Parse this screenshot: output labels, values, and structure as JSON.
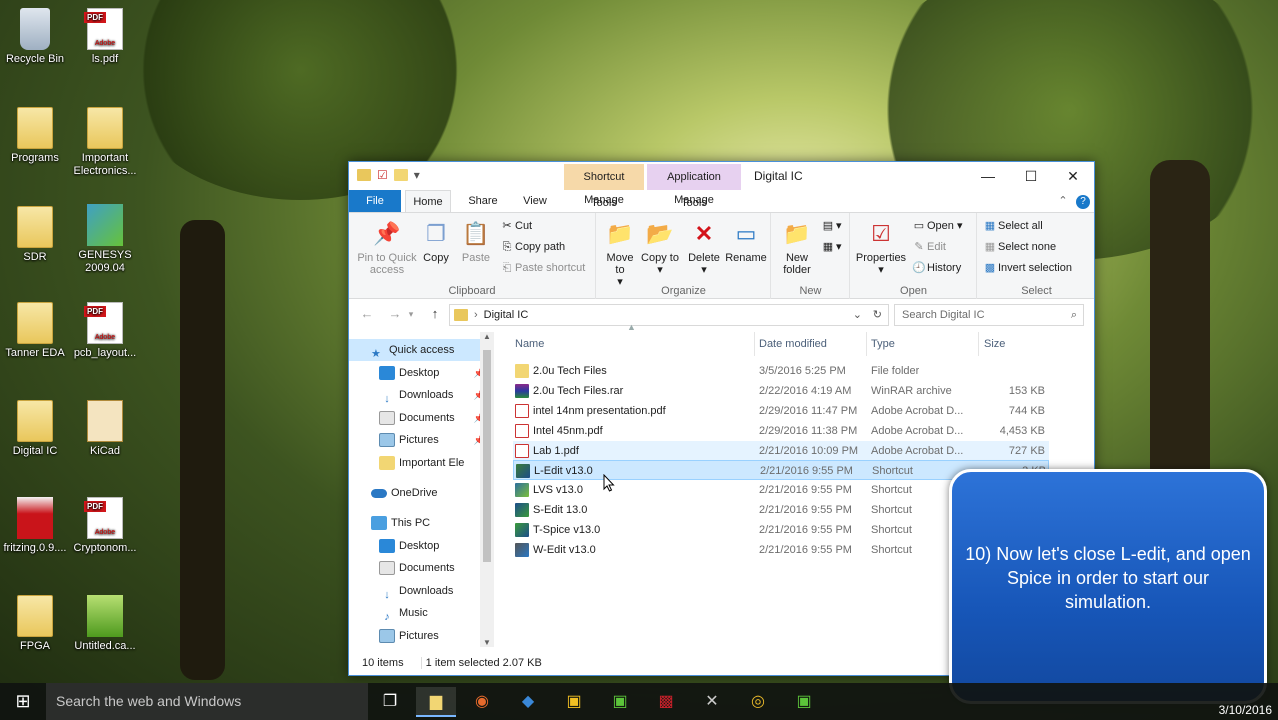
{
  "desktop": {
    "icons": [
      {
        "label": "Recycle Bin",
        "icon": "recycle-bin-icon"
      },
      {
        "label": "ls.pdf",
        "icon": "pdf-file-icon"
      },
      {
        "label": "Programs",
        "icon": "folder-icon"
      },
      {
        "label": "Important Electronics...",
        "icon": "folder-icon"
      },
      {
        "label": "SDR",
        "icon": "folder-icon"
      },
      {
        "label": "GENESYS 2009.04",
        "icon": "genesys-app-icon"
      },
      {
        "label": "Tanner EDA",
        "icon": "folder-icon"
      },
      {
        "label": "pcb_layout...",
        "icon": "pdf-file-icon"
      },
      {
        "label": "Digital IC",
        "icon": "folder-icon"
      },
      {
        "label": "KiCad",
        "icon": "kicad-app-icon"
      },
      {
        "label": "fritzing.0.9....",
        "icon": "folder-icon"
      },
      {
        "label": "Cryptonom...",
        "icon": "pdf-file-icon"
      },
      {
        "label": "FPGA",
        "icon": "folder-icon"
      },
      {
        "label": "Untitled.ca...",
        "icon": "cad-file-icon"
      }
    ]
  },
  "window": {
    "title": "Digital IC",
    "context_tabs": [
      {
        "header": "Shortcut Tools",
        "tab": "Manage",
        "color": "#f6d9a9"
      },
      {
        "header": "Application Tools",
        "tab": "Manage",
        "color": "#e7d1f0"
      }
    ],
    "tabs": [
      "File",
      "Home",
      "Share",
      "View"
    ],
    "ribbon": {
      "clipboard": {
        "title": "Clipboard",
        "pin": "Pin to Quick access",
        "copy": "Copy",
        "paste": "Paste",
        "cut": "Cut",
        "copy_path": "Copy path",
        "paste_shortcut": "Paste shortcut"
      },
      "organize": {
        "title": "Organize",
        "move_to": "Move to",
        "copy_to": "Copy to",
        "delete": "Delete",
        "rename": "Rename"
      },
      "new": {
        "title": "New",
        "new_folder": "New folder"
      },
      "open": {
        "title": "Open",
        "properties": "Properties",
        "open": "Open",
        "edit": "Edit",
        "history": "History"
      },
      "select": {
        "title": "Select",
        "select_all": "Select all",
        "select_none": "Select none",
        "invert": "Invert selection"
      }
    },
    "address": {
      "path": "Digital IC",
      "search_placeholder": "Search Digital IC"
    },
    "nav": {
      "quick_access": "Quick access",
      "quick_items": [
        "Desktop",
        "Downloads",
        "Documents",
        "Pictures",
        "Important Ele"
      ],
      "onedrive": "OneDrive",
      "this_pc": "This PC",
      "pc_items": [
        "Desktop",
        "Documents",
        "Downloads",
        "Music",
        "Pictures"
      ]
    },
    "columns": [
      "Name",
      "Date modified",
      "Type",
      "Size"
    ],
    "files": [
      {
        "name": "2.0u Tech Files",
        "date": "3/5/2016 5:25 PM",
        "type": "File folder",
        "size": "",
        "icon": "folder-icon"
      },
      {
        "name": "2.0u Tech Files.rar",
        "date": "2/22/2016 4:19 AM",
        "type": "WinRAR archive",
        "size": "153 KB",
        "icon": "rar-file-icon"
      },
      {
        "name": "intel 14nm presentation.pdf",
        "date": "2/29/2016 11:47 PM",
        "type": "Adobe Acrobat D...",
        "size": "744 KB",
        "icon": "pdf-file-icon"
      },
      {
        "name": "Intel 45nm.pdf",
        "date": "2/29/2016 11:38 PM",
        "type": "Adobe Acrobat D...",
        "size": "4,453 KB",
        "icon": "pdf-file-icon"
      },
      {
        "name": "Lab 1.pdf",
        "date": "2/21/2016 10:09 PM",
        "type": "Adobe Acrobat D...",
        "size": "727 KB",
        "icon": "pdf-file-icon"
      },
      {
        "name": "L-Edit v13.0",
        "date": "2/21/2016 9:55 PM",
        "type": "Shortcut",
        "size": "3 KB",
        "icon": "ledit-shortcut-icon"
      },
      {
        "name": "LVS v13.0",
        "date": "2/21/2016 9:55 PM",
        "type": "Shortcut",
        "size": "",
        "icon": "lvs-shortcut-icon"
      },
      {
        "name": "S-Edit 13.0",
        "date": "2/21/2016 9:55 PM",
        "type": "Shortcut",
        "size": "",
        "icon": "sedit-shortcut-icon"
      },
      {
        "name": "T-Spice v13.0",
        "date": "2/21/2016 9:55 PM",
        "type": "Shortcut",
        "size": "",
        "icon": "tspice-shortcut-icon"
      },
      {
        "name": "W-Edit v13.0",
        "date": "2/21/2016 9:55 PM",
        "type": "Shortcut",
        "size": "",
        "icon": "wedit-shortcut-icon"
      }
    ],
    "status": {
      "count": "10 items",
      "selected": "1 item selected  2.07 KB"
    }
  },
  "callout": {
    "text": "10) Now let's close L-edit, and open Spice in order to start our simulation."
  },
  "taskbar": {
    "search_placeholder": "Search the web and Windows",
    "clock": "3/10/2016"
  }
}
